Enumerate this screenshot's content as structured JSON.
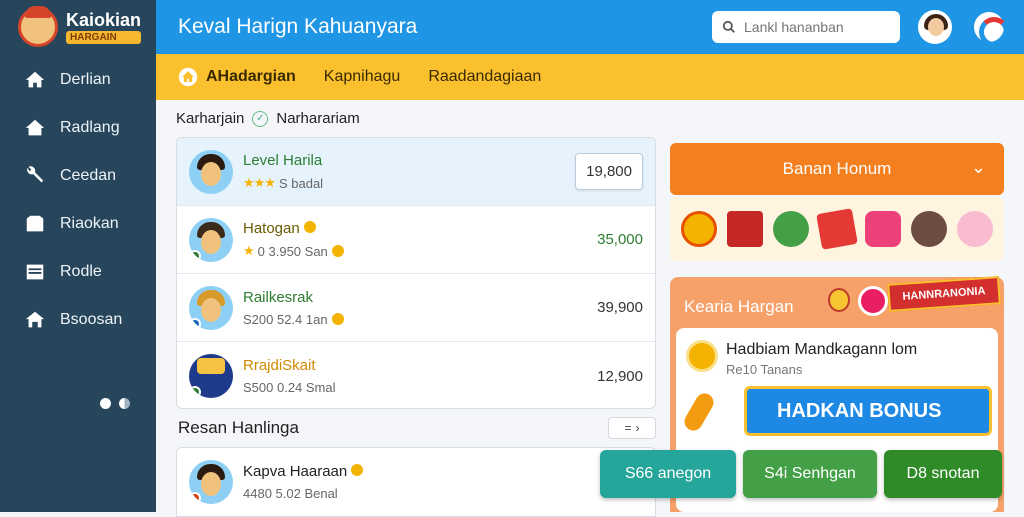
{
  "brand": {
    "name": "Kaiokian",
    "sub": "HARGAIN"
  },
  "header": {
    "title": "Keval Harign Kahuanyara"
  },
  "search": {
    "placeholder": "Lankl hananban"
  },
  "sidebar": {
    "items": [
      {
        "label": "Derlian",
        "icon": "home-icon"
      },
      {
        "label": "Radlang",
        "icon": "house-icon"
      },
      {
        "label": "Ceedan",
        "icon": "tools-icon"
      },
      {
        "label": "Riaokan",
        "icon": "inbox-icon"
      },
      {
        "label": "Rodle",
        "icon": "list-icon"
      },
      {
        "label": "Bsoosan",
        "icon": "store-icon"
      }
    ]
  },
  "subnav": {
    "tabs": [
      "AHadargian",
      "Kapnihagu",
      "Raadandagiaan"
    ]
  },
  "breadcrumb": {
    "section": "Karharjain",
    "sub": "Narharariam"
  },
  "list": [
    {
      "name": "Level Harila",
      "meta": "S badal",
      "amount": "19,800",
      "color": "green"
    },
    {
      "name": "Hatogan",
      "meta": "0 3.950 San",
      "amount": "35,000",
      "color": "dark"
    },
    {
      "name": "Railkesrak",
      "meta": "S200 52.4 1an",
      "amount": "39,900",
      "color": "green"
    },
    {
      "name": "RrajdiSkait",
      "meta": "S500 0.24 Smal",
      "amount": "12,900",
      "color": "org"
    }
  ],
  "section2": {
    "title": "Resan Hanlinga",
    "sort_label": "="
  },
  "list2": [
    {
      "name": "Kapva Haaraan",
      "meta": "4480 5.02 Benal"
    }
  ],
  "bonus": {
    "dropdown_label": "Banan Honum"
  },
  "panel": {
    "title": "Kearia Hargan",
    "tag": "HANNRANONIA",
    "card_title": "Hadbiam Mandkagann lom",
    "card_sub": "Re10 Tanans",
    "banner": "HADKAN BONUS"
  },
  "actions": [
    {
      "label": "S66 anegon",
      "color": "#26a69a"
    },
    {
      "label": "S4i Senhgan",
      "color": "#43a047"
    },
    {
      "label": "D8 snotan",
      "color": "#2e8b28"
    }
  ]
}
